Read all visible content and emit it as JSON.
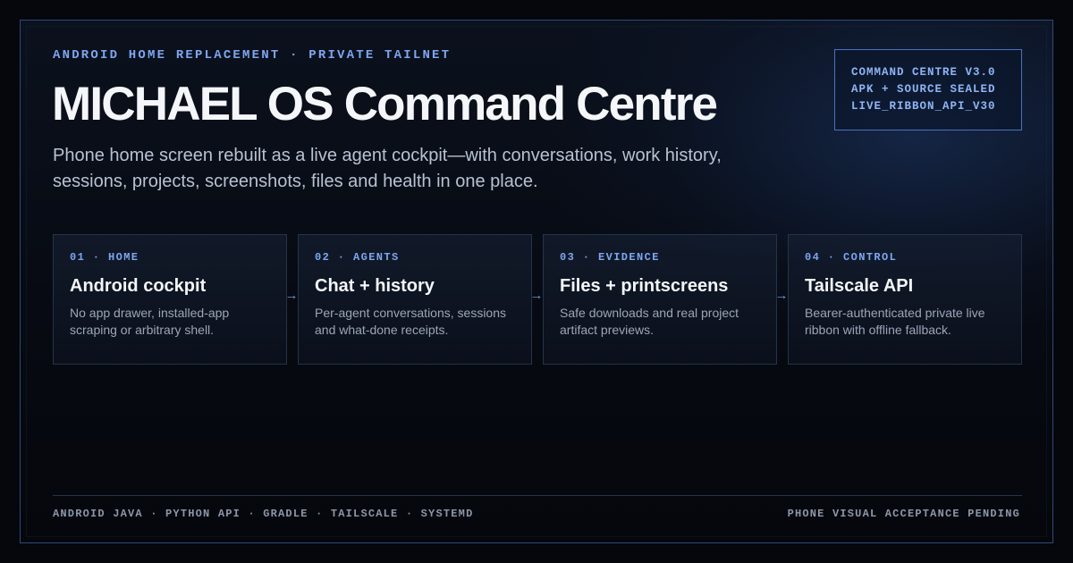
{
  "header": {
    "kicker": "ANDROID HOME REPLACEMENT · PRIVATE TAILNET",
    "title": "MICHAEL OS Command Centre",
    "subtitle": "Phone home screen rebuilt as a live agent cockpit—with conversations, work history, sessions, projects, screenshots, files and health in one place."
  },
  "badge": {
    "lines": [
      "COMMAND CENTRE V3.0",
      "APK + SOURCE SEALED",
      "LIVE_RIBBON_API_V30"
    ]
  },
  "cards": [
    {
      "label": "01 · HOME",
      "title": "Android cockpit",
      "desc": "No app drawer, installed-app scraping or arbitrary shell."
    },
    {
      "label": "02 · AGENTS",
      "title": "Chat + history",
      "desc": "Per-agent conversations, sessions and what-done receipts."
    },
    {
      "label": "03 · EVIDENCE",
      "title": "Files + printscreens",
      "desc": "Safe downloads and real project artifact previews."
    },
    {
      "label": "04 · CONTROL",
      "title": "Tailscale API",
      "desc": "Bearer-authenticated private live ribbon with offline fallback."
    }
  ],
  "arrow_glyph": "→",
  "footer": {
    "stack": "ANDROID JAVA · PYTHON API · GRADLE · TAILSCALE · SYSTEMD",
    "status": "PHONE VISUAL ACCEPTANCE PENDING"
  },
  "colors": {
    "accent": "#7ea6f0",
    "border": "#2e4a78",
    "background": "#05070c"
  }
}
